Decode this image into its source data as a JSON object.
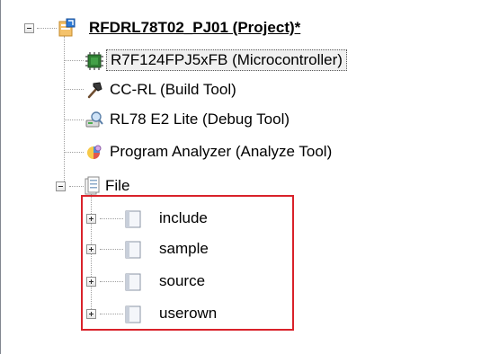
{
  "tree": {
    "project": {
      "label": "RFDRL78T02_PJ01 (Project)*",
      "expander": "minus",
      "icon": "project-icon"
    },
    "items": [
      {
        "label": "R7F124FPJ5xFB (Microcontroller)",
        "icon": "microcontroller-icon",
        "selected": true
      },
      {
        "label": "CC-RL (Build Tool)",
        "icon": "build-tool-icon"
      },
      {
        "label": "RL78 E2 Lite (Debug Tool)",
        "icon": "debug-tool-icon"
      },
      {
        "label": "Program Analyzer (Analyze Tool)",
        "icon": "analyze-tool-icon"
      }
    ],
    "file_node": {
      "label": "File",
      "expander": "minus",
      "icon": "file-folder-icon",
      "children": [
        {
          "label": "include",
          "expander": "plus",
          "icon": "folder-icon"
        },
        {
          "label": "sample",
          "expander": "plus",
          "icon": "folder-icon"
        },
        {
          "label": "source",
          "expander": "plus",
          "icon": "folder-icon"
        },
        {
          "label": "userown",
          "expander": "plus",
          "icon": "folder-icon"
        }
      ]
    }
  },
  "colors": {
    "highlight_border": "#d9222a",
    "tree_lines": "#a0a0a0",
    "selection_bg": "#f0f0f0"
  }
}
